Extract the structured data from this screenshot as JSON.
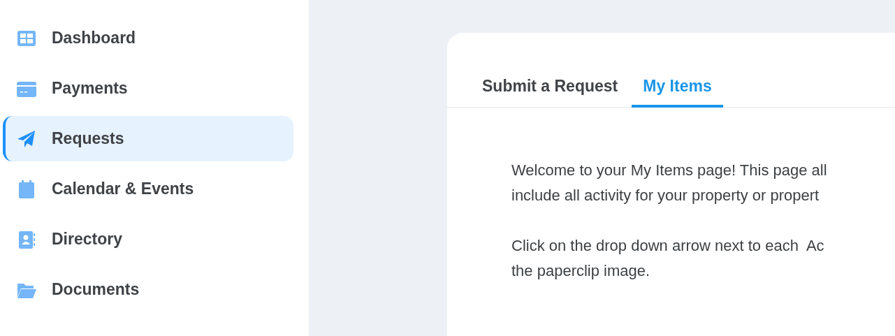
{
  "sidebar": {
    "items": [
      {
        "label": "Dashboard",
        "selected": false
      },
      {
        "label": "Payments",
        "selected": false
      },
      {
        "label": "Requests",
        "selected": true
      },
      {
        "label": "Calendar & Events",
        "selected": false
      },
      {
        "label": "Directory",
        "selected": false
      },
      {
        "label": "Documents",
        "selected": false
      }
    ]
  },
  "tabs": [
    {
      "label": "Submit a Request",
      "selected": false
    },
    {
      "label": "My Items",
      "selected": true
    }
  ],
  "paragraphs": [
    [
      "Welcome to your My Items page! This page all",
      "include all activity for your property or propert"
    ],
    [
      "Click on the drop down arrow next to each  Ac",
      "the paperclip image."
    ]
  ]
}
